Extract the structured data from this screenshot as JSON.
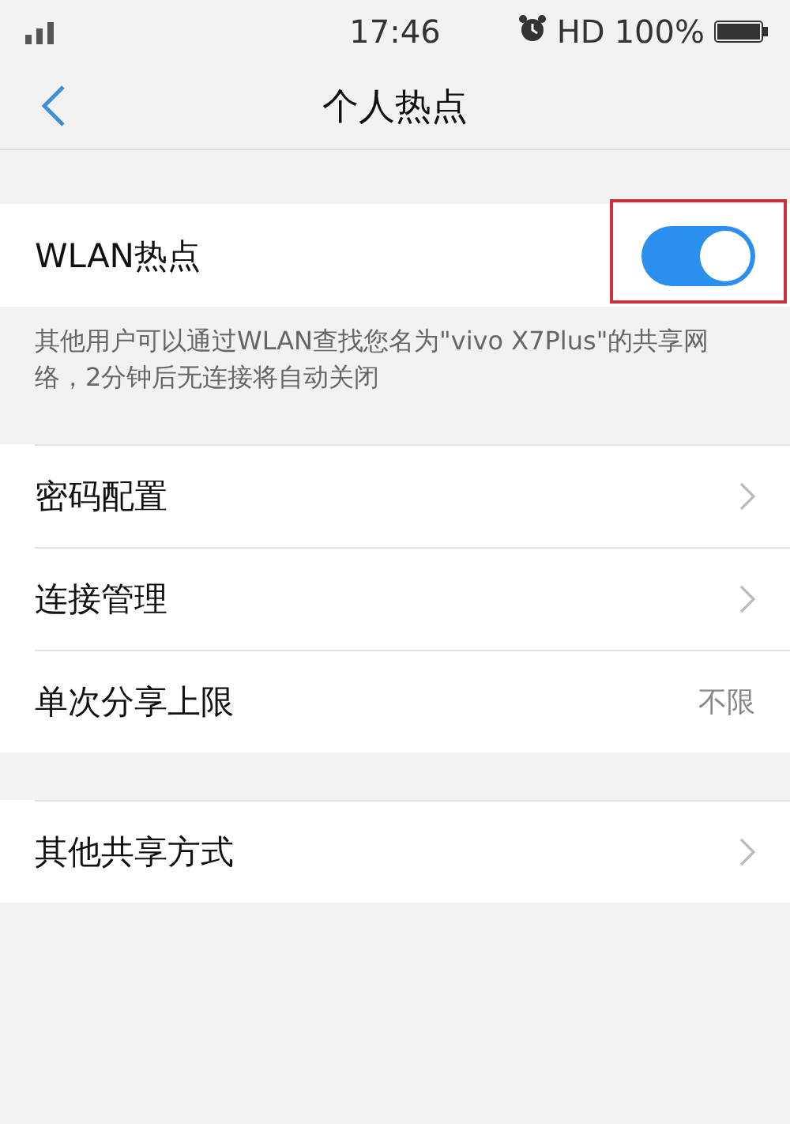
{
  "status_bar": {
    "time": "17:46",
    "network": "HD",
    "battery": "100%",
    "alarm": true
  },
  "nav": {
    "title": "个人热点"
  },
  "hotspot": {
    "label": "WLAN热点",
    "on": true,
    "highlighted": true,
    "description": "其他用户可以通过WLAN查找您名为\"vivo X7Plus\"的共享网络，2分钟后无连接将自动关闭"
  },
  "groups": [
    {
      "items": [
        {
          "label": "密码配置",
          "kind": "link"
        },
        {
          "label": "连接管理",
          "kind": "link"
        },
        {
          "label": "单次分享上限",
          "kind": "value",
          "value": "不限"
        }
      ]
    },
    {
      "items": [
        {
          "label": "其他共享方式",
          "kind": "link"
        }
      ]
    }
  ]
}
